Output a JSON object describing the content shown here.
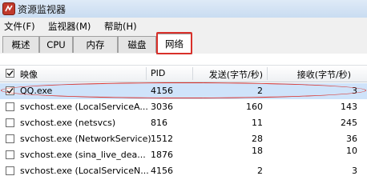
{
  "window": {
    "title": "资源监视器"
  },
  "menu": [
    {
      "label": "文件(F)"
    },
    {
      "label": "监视器(M)"
    },
    {
      "label": "帮助(H)"
    }
  ],
  "tabs": [
    {
      "label": "概述"
    },
    {
      "label": "CPU"
    },
    {
      "label": "内存"
    },
    {
      "label": "磁盘"
    },
    {
      "label": "网络",
      "active": true
    }
  ],
  "table": {
    "columns": [
      "映像",
      "PID",
      "发送(字节/秒)",
      "接收(字节/秒)"
    ],
    "rows": [
      {
        "image": "QQ.exe",
        "pid": "4156",
        "send": "2",
        "recv": "3",
        "checked": true
      },
      {
        "image": "svchost.exe (LocalServiceA...",
        "pid": "3036",
        "send": "160",
        "recv": "143",
        "checked": false
      },
      {
        "image": "svchost.exe (netsvcs)",
        "pid": "816",
        "send": "11",
        "recv": "245",
        "checked": false
      },
      {
        "image": "svchost.exe (NetworkService)",
        "pid": "1512",
        "send": "28",
        "recv": "36",
        "checked": false
      },
      {
        "image": "svchost.exe (sina_live_dea...",
        "pid": "1876",
        "send": "18",
        "recv": "10",
        "checked": false
      },
      {
        "image": "svchost.exe (LocalServiceN...",
        "pid": "4156",
        "send": "2",
        "recv": "3",
        "checked": false
      }
    ]
  },
  "colors": {
    "highlight": "#d9302a",
    "selection": "#cfe3fa"
  }
}
